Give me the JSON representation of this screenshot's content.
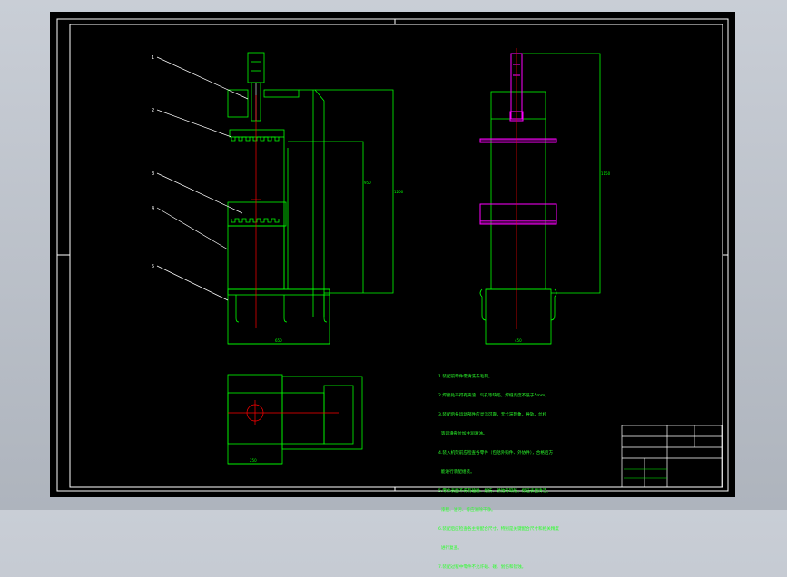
{
  "drawing": {
    "background": "#000000",
    "colors": {
      "frame": "#ffffff",
      "outline": "#00ff00",
      "centerline": "#ff0000",
      "highlight": "#ff00ff",
      "leader": "#ffffff"
    }
  },
  "callouts": [
    "1",
    "2",
    "3",
    "4",
    "5"
  ],
  "dimensions": {
    "front_height_inner": "950",
    "front_height_outer": "1200",
    "front_width": "650",
    "side_height": "1150",
    "side_width": "450",
    "plan_width": "250"
  },
  "technical_notes": [
    "1.装配前零件需清洗去毛刺。",
    "2.焊接处不得有夹渣、气孔等缺陷，焊缝高度不低于5mm。",
    "3.装配后各运动部件应灵活可靠，无卡滞现象，导轨、丝杠",
    "  等润滑部位加注润滑油。",
    "4.装入机架前应检查各零件（包括外购件、外协件），合格后方",
    "  能进行装配组装。",
    "5.零件表面不得有磕碰、划伤、锈蚀等缺陷，保证表面清洁。",
    "  漆膜、油污、等应清除干净。",
    "6.装配后应检查各主要配合尺寸，特别是关键配合尺寸和相关精度",
    "  进行复查。",
    "7.装配过程中零件不允许磕、碰、划伤和锈蚀。"
  ],
  "title_block": {
    "drawing_name": "",
    "scale_label": "",
    "sheet_label": ""
  }
}
